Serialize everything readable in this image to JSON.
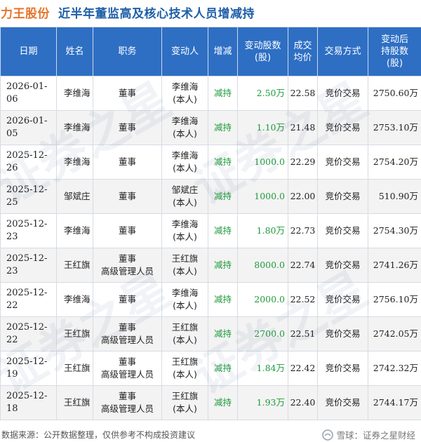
{
  "header": {
    "company": "力王股份",
    "title": "近半年董监高及核心技术人员增减持"
  },
  "table": {
    "columns": [
      "日期",
      "姓名",
      "职务",
      "变动人",
      "增减",
      "变动股数\n(股)",
      "成交\n均价",
      "交易方式",
      "变动后\n持股数\n(股)"
    ],
    "rows": [
      {
        "date": "2026-01-06",
        "name": "李维海",
        "role": [
          "董事"
        ],
        "changer": [
          "李维海",
          "(本人)"
        ],
        "direction": "减持",
        "shares": "2.50",
        "shares_unit": "万",
        "price": "22.58",
        "method": "竞价交易",
        "after": "2750.60",
        "after_unit": "万"
      },
      {
        "date": "2026-01-05",
        "name": "李维海",
        "role": [
          "董事"
        ],
        "changer": [
          "李维海",
          "(本人)"
        ],
        "direction": "减持",
        "shares": "1.10",
        "shares_unit": "万",
        "price": "21.48",
        "method": "竞价交易",
        "after": "2753.10",
        "after_unit": "万"
      },
      {
        "date": "2025-12-26",
        "name": "李维海",
        "role": [
          "董事"
        ],
        "changer": [
          "李维海",
          "(本人)"
        ],
        "direction": "减持",
        "shares": "1000.0",
        "shares_unit": "",
        "price": "22.29",
        "method": "竞价交易",
        "after": "2754.20",
        "after_unit": "万"
      },
      {
        "date": "2025-12-25",
        "name": "邹斌庄",
        "role": [
          "董事"
        ],
        "changer": [
          "邹斌庄",
          "(本人)"
        ],
        "direction": "减持",
        "shares": "1000.0",
        "shares_unit": "",
        "price": "22.00",
        "method": "竞价交易",
        "after": "510.90",
        "after_unit": "万"
      },
      {
        "date": "2025-12-23",
        "name": "李维海",
        "role": [
          "董事"
        ],
        "changer": [
          "李维海",
          "(本人)"
        ],
        "direction": "减持",
        "shares": "1.80",
        "shares_unit": "万",
        "price": "22.73",
        "method": "竞价交易",
        "after": "2754.30",
        "after_unit": "万"
      },
      {
        "date": "2025-12-23",
        "name": "王红旗",
        "role": [
          "董事",
          "高级管理人员"
        ],
        "changer": [
          "王红旗",
          "(本人)"
        ],
        "direction": "减持",
        "shares": "8000.0",
        "shares_unit": "",
        "price": "22.74",
        "method": "竞价交易",
        "after": "2741.26",
        "after_unit": "万"
      },
      {
        "date": "2025-12-22",
        "name": "李维海",
        "role": [
          "董事"
        ],
        "changer": [
          "李维海",
          "(本人)"
        ],
        "direction": "减持",
        "shares": "2000.0",
        "shares_unit": "",
        "price": "22.52",
        "method": "竞价交易",
        "after": "2756.10",
        "after_unit": "万"
      },
      {
        "date": "2025-12-22",
        "name": "王红旗",
        "role": [
          "董事",
          "高级管理人员"
        ],
        "changer": [
          "王红旗",
          "(本人)"
        ],
        "direction": "减持",
        "shares": "2700.0",
        "shares_unit": "",
        "price": "22.51",
        "method": "竞价交易",
        "after": "2742.05",
        "after_unit": "万"
      },
      {
        "date": "2025-12-19",
        "name": "王红旗",
        "role": [
          "董事",
          "高级管理人员"
        ],
        "changer": [
          "王红旗",
          "(本人)"
        ],
        "direction": "减持",
        "shares": "1.84",
        "shares_unit": "万",
        "price": "22.42",
        "method": "竞价交易",
        "after": "2742.32",
        "after_unit": "万"
      },
      {
        "date": "2025-12-18",
        "name": "王红旗",
        "role": [
          "董事",
          "高级管理人员"
        ],
        "changer": [
          "王红旗",
          "(本人)"
        ],
        "direction": "减持",
        "shares": "1.93",
        "shares_unit": "万",
        "price": "22.40",
        "method": "竞价交易",
        "after": "2744.17",
        "after_unit": "万"
      }
    ]
  },
  "footer": {
    "source": "数据来源：公开数据整理，仅供参考不构成投资建议",
    "brand": "雪球：证券之星财经"
  },
  "watermark": "证券之星",
  "colors": {
    "header_bg": "#2e6fc4",
    "company_title": "#e8742a",
    "main_title": "#1f5fa8",
    "decrease_green": "#1e9b3b",
    "row_alt": "#f3f3f3"
  },
  "icons": {
    "brand_logo": "snowball-logo-icon"
  }
}
